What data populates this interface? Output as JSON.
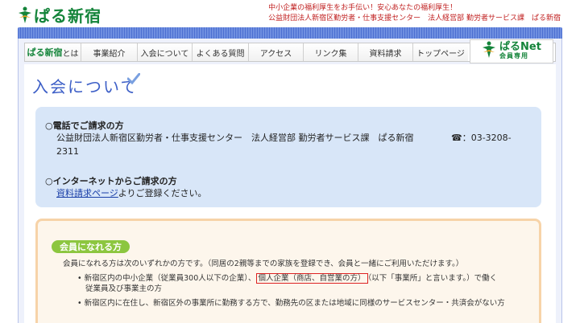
{
  "header": {
    "logo_text": "ぱる新宿",
    "tagline_line1": "中小企業の福利厚生をお手伝い！安心あなたの福利厚生！",
    "tagline_line2": "公益財団法人新宿区勤労者・仕事支援センター　法人経営部 勤労者サービス課　ぱる新宿"
  },
  "nav": {
    "items": [
      {
        "pa": "ぱる新宿",
        "rest": "とは"
      },
      {
        "label": "事業紹介"
      },
      {
        "label": "入会について"
      },
      {
        "label": "よくある質問"
      },
      {
        "label": "アクセス"
      },
      {
        "label": "リンク集"
      },
      {
        "label": "資料請求"
      },
      {
        "label": "トップページ"
      }
    ],
    "net_title": "ぱるNet",
    "net_sub": "会員専用"
  },
  "page_title": "入会について",
  "info": {
    "phone_heading": "○電話でご請求の方",
    "phone_line1": "公益財団法人新宿区勤労者・仕事支援センター　法人経営部 勤労者サービス課　ぱる新宿",
    "phone_number_prefix": "☎：03-3208-",
    "phone_number_cont": "2311",
    "internet_heading": "○インターネットからご請求の方",
    "internet_link": "資料請求ページ",
    "internet_rest": "よりご登録ください。"
  },
  "member": {
    "label": "会員になれる方",
    "intro": "会員になれる方は次のいずれかの方です。（同居の2親等までの家族を登録でき、会員と一緒にご利用いただけます。）",
    "bullet1_pre": "新宿区内の中小企業（従業員300人以下の企業）、",
    "bullet1_highlight": "個人企業（商店、自営業の方）",
    "bullet1_post": "（以下「事業所」と言います。）で働く",
    "bullet1_line2": "従業員及び事業主の方",
    "bullet2": "新宿区内に在住し、新宿区外の事業所に勤務する方で、勤務先の区または地域に同様のサービスセンター・共済会がない方"
  },
  "colors": {
    "brand_green": "#14843a",
    "title_blue": "#3d5fc7",
    "label_green": "#8cc63f",
    "highlight_red": "#dd2222"
  }
}
